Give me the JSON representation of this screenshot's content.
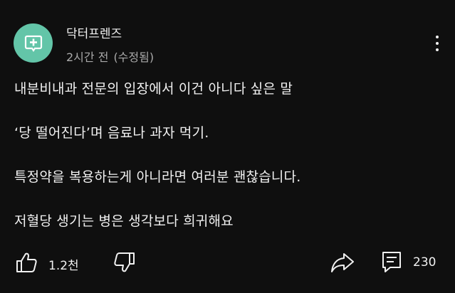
{
  "channel": {
    "name": "닥터프렌즈",
    "avatar_color": "#63c5a8",
    "avatar_icon": "medical-cross-chat-icon"
  },
  "meta": {
    "time": "2시간 전",
    "edited": "(수정됨)"
  },
  "post": {
    "lines": [
      "내분비내과 전문의 입장에서 이건 아니다 싶은 말",
      "‘당 떨어진다’며 음료나 과자 먹기.",
      "특정약을 복용하는게 아니라면 여러분 괜찮습니다.",
      "저혈당 생기는 병은 생각보다 희귀해요"
    ]
  },
  "actions": {
    "like_count": "1.2천",
    "comment_count": "230",
    "like_icon": "thumbs-up-icon",
    "dislike_icon": "thumbs-down-icon",
    "share_icon": "share-arrow-icon",
    "comment_icon": "comment-icon"
  },
  "colors": {
    "background": "#0f0f0f",
    "text": "#f1f1f1",
    "secondary_text": "#aaaaaa"
  }
}
